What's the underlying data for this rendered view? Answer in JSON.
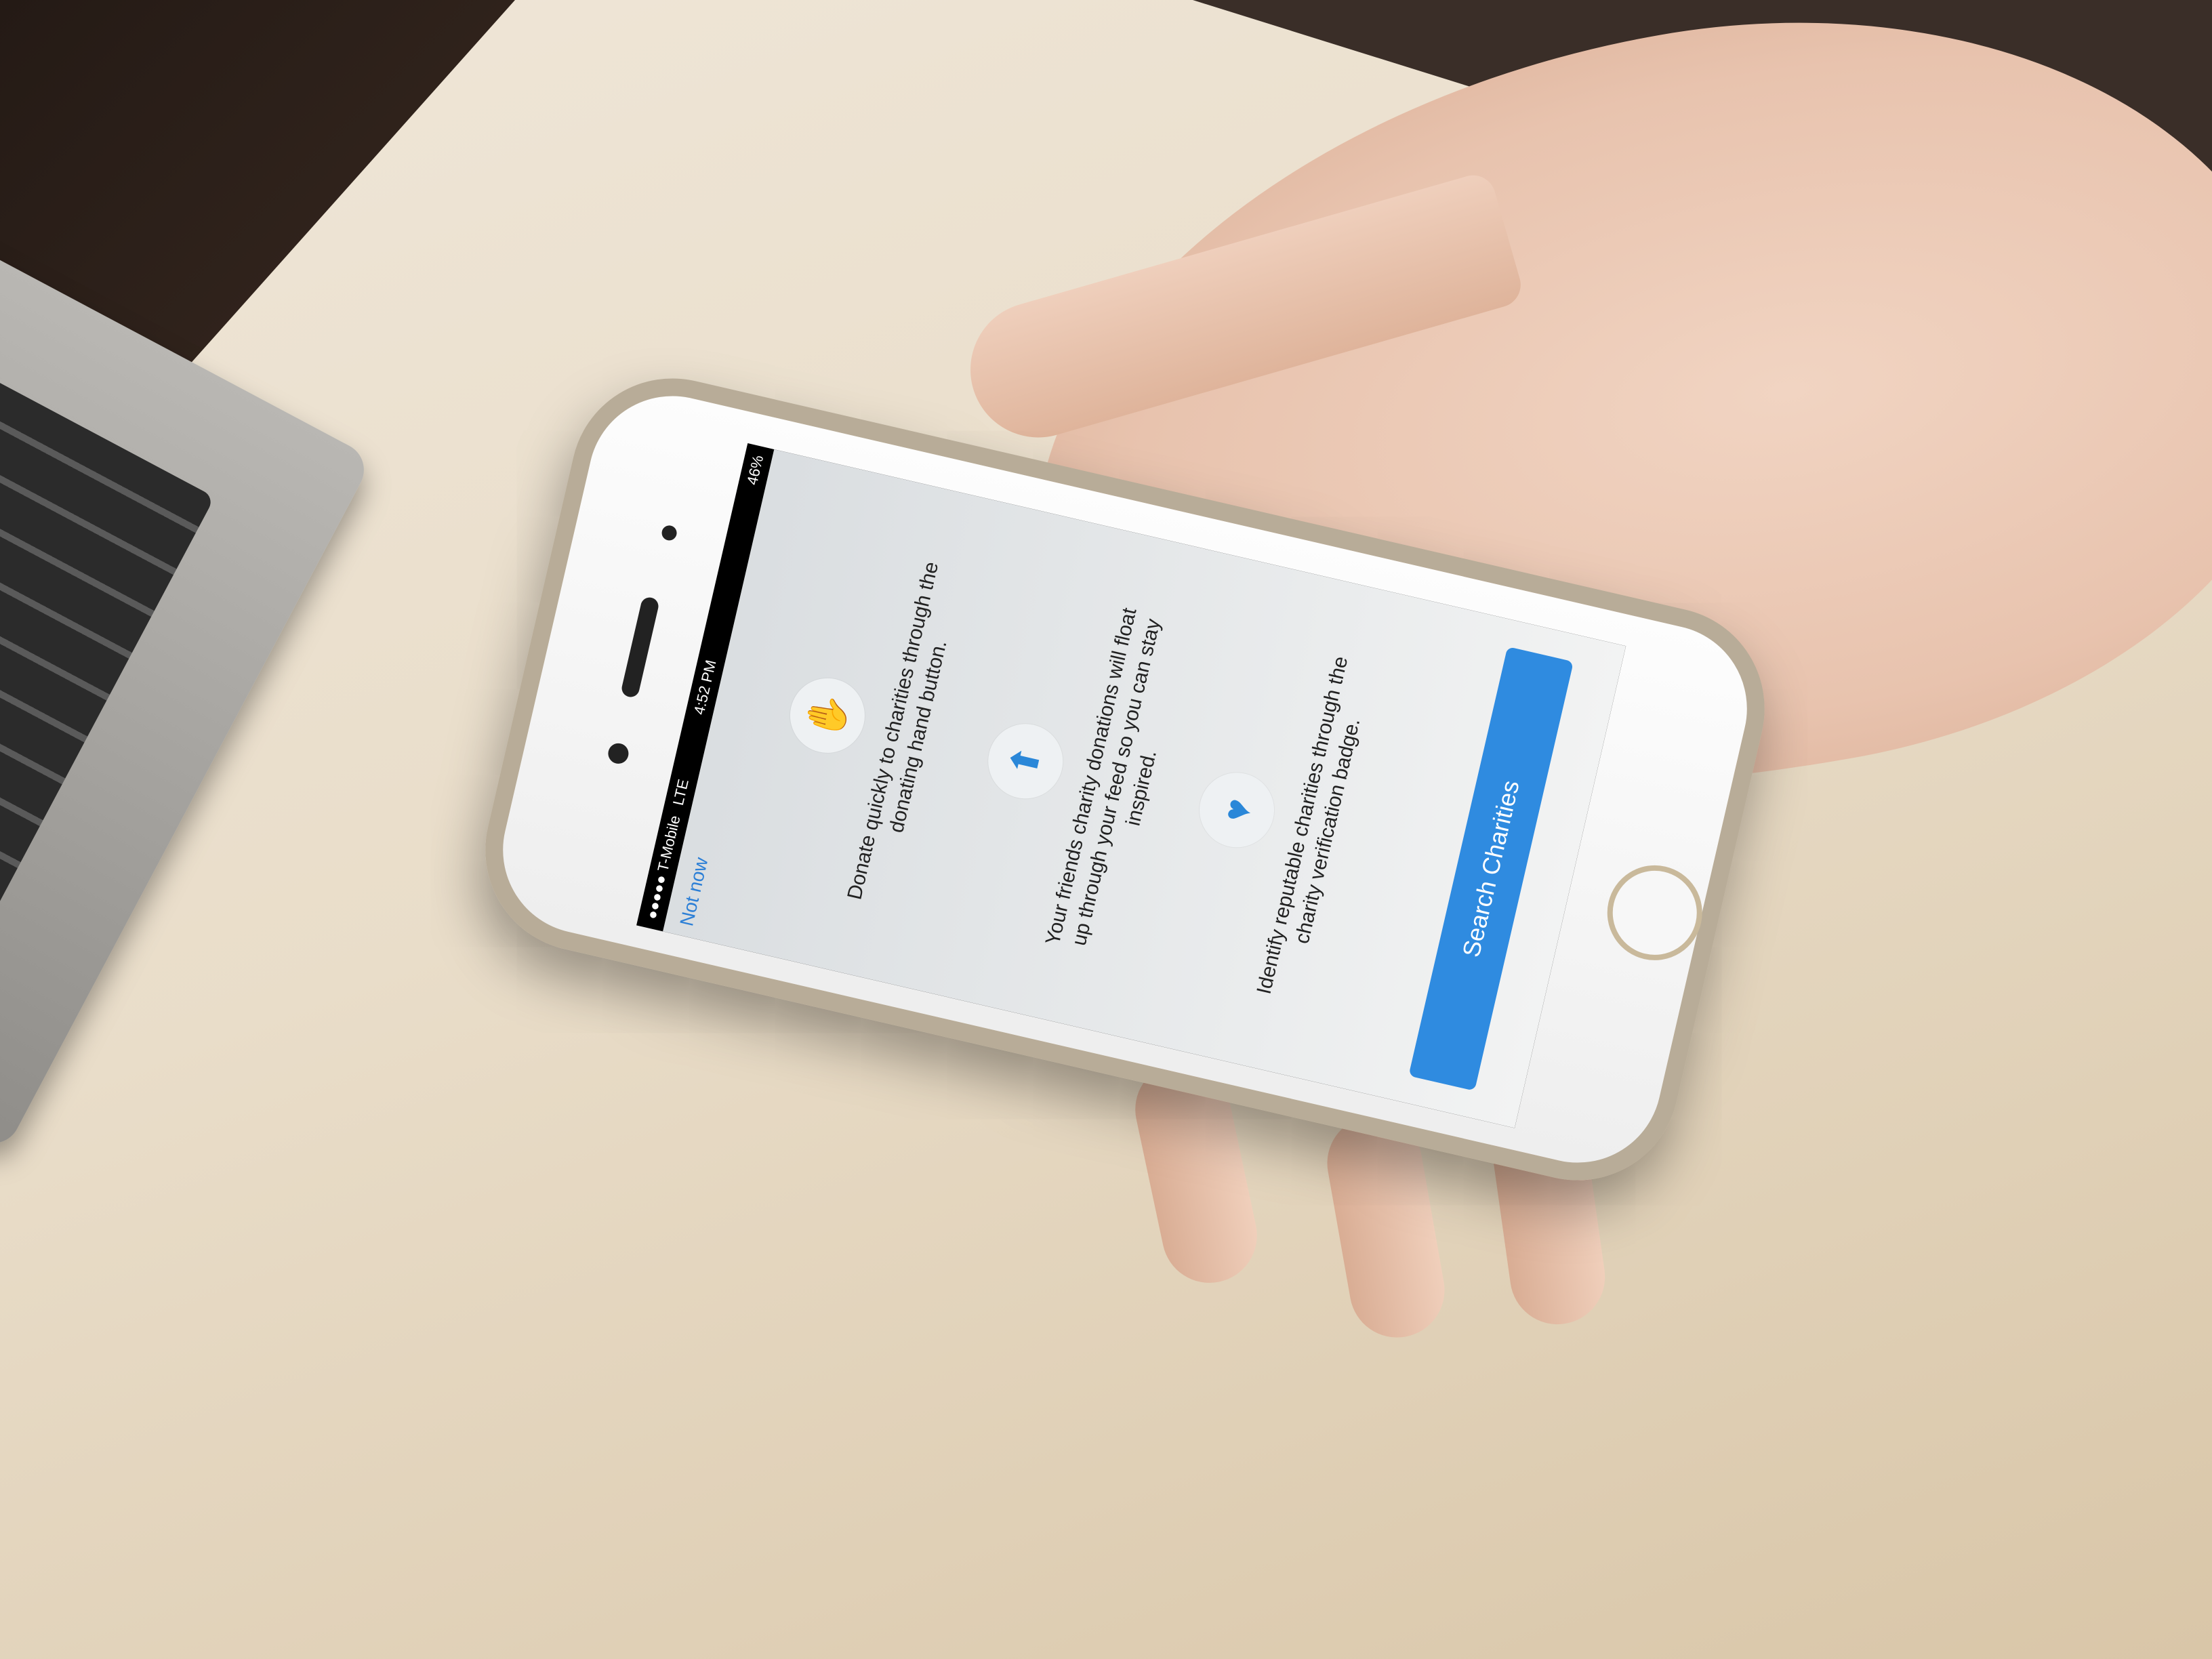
{
  "status_bar": {
    "carrier": "●●●●● T-Mobile",
    "network": "LTE",
    "time": "4:52 PM",
    "battery": "46%"
  },
  "header": {
    "not_now_label": "Not now"
  },
  "features": [
    {
      "icon": "donating-hand-icon",
      "text": "Donate quickly to charities through the donating hand  button."
    },
    {
      "icon": "float-up-arrow-icon",
      "text": "Your friends charity donations will float up through your feed so you can stay inspired."
    },
    {
      "icon": "verified-heart-dollar-icon",
      "text": "Identify reputable charities through the charity verification badge."
    }
  ],
  "cta": {
    "label": "Search Charities"
  },
  "colors": {
    "accent": "#2f8be0",
    "link": "#2c7fd6"
  }
}
